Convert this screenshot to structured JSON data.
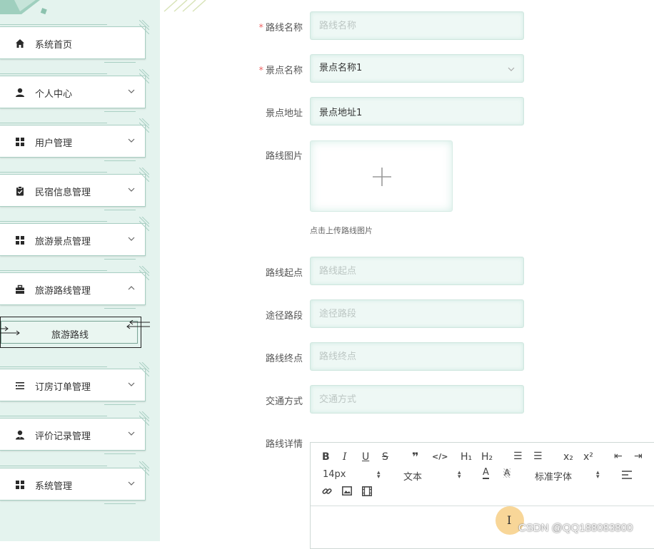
{
  "sidebar": {
    "items": [
      {
        "label": "系统首页",
        "icon": "home-icon",
        "has_caret": false
      },
      {
        "label": "个人中心",
        "icon": "person-icon",
        "has_caret": true,
        "expanded": false
      },
      {
        "label": "用户管理",
        "icon": "grid-icon",
        "has_caret": true,
        "expanded": false
      },
      {
        "label": "民宿信息管理",
        "icon": "clipboard-check-icon",
        "has_caret": true,
        "expanded": false
      },
      {
        "label": "旅游景点管理",
        "icon": "grid-icon",
        "has_caret": true,
        "expanded": false
      },
      {
        "label": "旅游路线管理",
        "icon": "briefcase-icon",
        "has_caret": true,
        "expanded": true
      },
      {
        "label": "订房订单管理",
        "icon": "list-icon",
        "has_caret": true,
        "expanded": false
      },
      {
        "label": "评价记录管理",
        "icon": "user-tie-icon",
        "has_caret": true,
        "expanded": false
      },
      {
        "label": "系统管理",
        "icon": "grid-icon",
        "has_caret": true,
        "expanded": false
      }
    ],
    "submenu": {
      "label": "旅游路线"
    }
  },
  "form": {
    "route_name": {
      "label": "路线名称",
      "required": true,
      "placeholder": "路线名称",
      "value": ""
    },
    "spot_name": {
      "label": "景点名称",
      "required": true,
      "value": "景点名称1"
    },
    "spot_address": {
      "label": "景点地址",
      "value": "景点地址1"
    },
    "route_image": {
      "label": "路线图片",
      "hint": "点击上传路线图片"
    },
    "start_point": {
      "label": "路线起点",
      "placeholder": "路线起点",
      "value": ""
    },
    "via_section": {
      "label": "途径路段",
      "placeholder": "途径路段",
      "value": ""
    },
    "end_point": {
      "label": "路线终点",
      "placeholder": "路线终点",
      "value": ""
    },
    "transport": {
      "label": "交通方式",
      "placeholder": "交通方式",
      "value": ""
    },
    "detail": {
      "label": "路线详情"
    }
  },
  "editor": {
    "font_size": "14px",
    "heading": "文本",
    "font_family": "标准字体",
    "buttons": {
      "bold": "B",
      "italic": "I",
      "underline": "U",
      "strike": "S",
      "quote": "❞",
      "code": "</>",
      "h1": "H₁",
      "h2": "H₂",
      "ordered_list": "☰",
      "bullet_list": "☰",
      "subscript": "x₂",
      "superscript": "x²",
      "outdent": "⇤",
      "indent": "⇥",
      "font_color": "A",
      "bg_color": "A"
    }
  },
  "watermark": "CSDN @QQ188083800",
  "colors": {
    "sidebar_bg": "#e4f3ee",
    "accent_border": "#a9cfc3",
    "input_bg": "#eef8f5",
    "required": "#ee6666"
  }
}
